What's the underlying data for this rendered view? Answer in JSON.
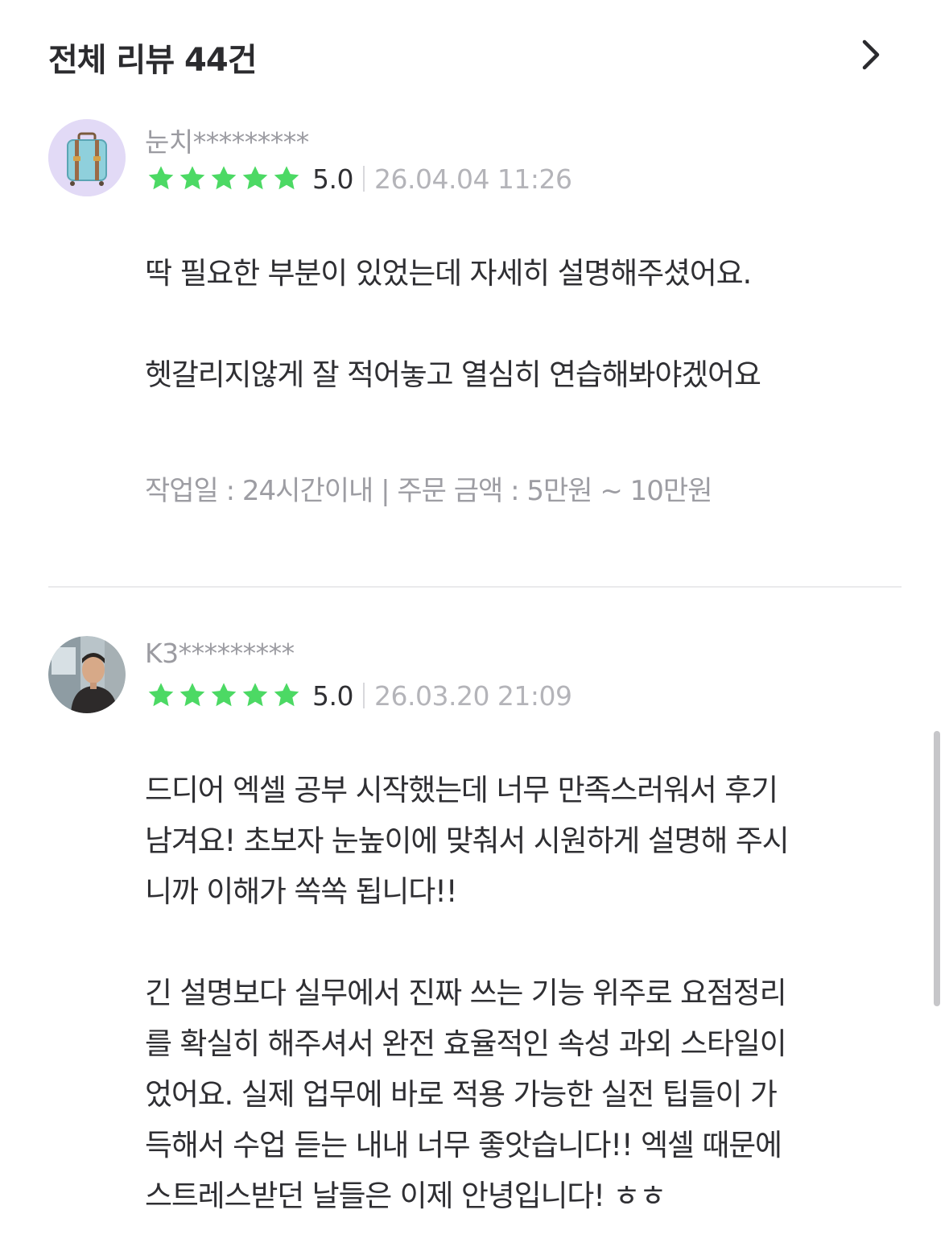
{
  "header": {
    "title": "전체 리뷰 44건",
    "chevron_icon": "chevron-right-icon"
  },
  "colors": {
    "star": "#4cd964",
    "muted_text": "#9b9ba1",
    "date_text": "#b4b4b9",
    "divider": "#eaeaec"
  },
  "reviews": [
    {
      "avatar_icon": "suitcase-avatar",
      "nickname": "눈치*********",
      "rating": 5,
      "score": "5.0",
      "date": "26.04.04 11:26",
      "paragraphs": [
        [
          "딱 필요한 부분이 있었는데  자세히 설명해주셨어요."
        ],
        [
          "헷갈리지않게 잘 적어놓고 열심히 연습해봐야겠어요"
        ]
      ],
      "meta": "작업일 : 24시간이내 | 주문 금액 : 5만원 ~ 10만원"
    },
    {
      "avatar_icon": "user-photo-avatar",
      "nickname": "K3*********",
      "rating": 5,
      "score": "5.0",
      "date": "26.03.20 21:09",
      "paragraphs": [
        [
          "드디어 엑셀 공부 시작했는데 너무 만족스러워서 후기",
          "남겨요! 초보자 눈높이에 맞춰서 시원하게 설명해 주시",
          "니까 이해가 쏙쏙 됩니다!!"
        ],
        [
          "긴 설명보다 실무에서 진짜 쓰는 기능 위주로 요점정리",
          "를 확실히 해주셔서 완전 효율적인 속성 과외 스타일이",
          "었어요. 실제 업무에 바로 적용 가능한 실전 팁들이 가",
          "득해서 수업 듣는 내내 너무 좋앗습니다!! 엑셀 때문에",
          "스트레스받던 날들은 이제 안녕입니다! ㅎㅎ"
        ]
      ]
    }
  ]
}
